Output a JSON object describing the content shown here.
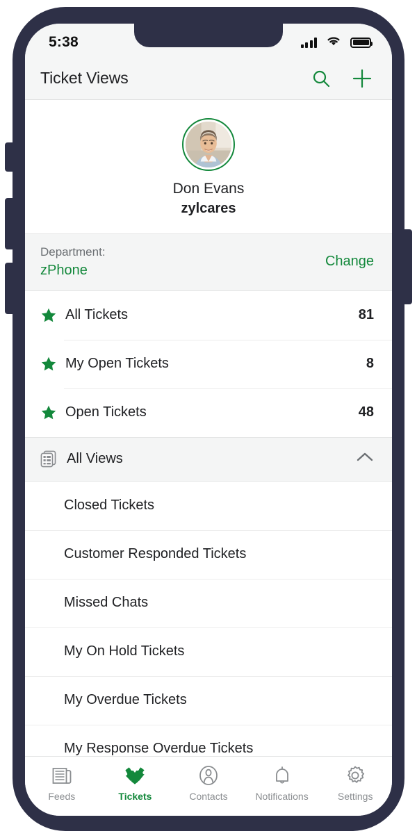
{
  "device": {
    "frame_color": "#2E3047",
    "accent_color": "#13883B"
  },
  "status_bar": {
    "time": "5:38",
    "signal_icon": "cellular-signal-icon",
    "wifi_icon": "wifi-icon",
    "battery_icon": "battery-full-icon"
  },
  "header": {
    "title": "Ticket Views",
    "search_icon": "search-icon",
    "add_icon": "plus-icon"
  },
  "profile": {
    "avatar": "user-avatar",
    "name": "Don Evans",
    "handle": "zylcares"
  },
  "department": {
    "label": "Department:",
    "value": "zPhone",
    "change_label": "Change"
  },
  "favorites": [
    {
      "icon": "star-icon",
      "label": "All Tickets",
      "count": "81"
    },
    {
      "icon": "star-icon",
      "label": "My Open Tickets",
      "count": "8"
    },
    {
      "icon": "star-icon",
      "label": "Open Tickets",
      "count": "48"
    }
  ],
  "all_views_section": {
    "icon": "list-documents-icon",
    "title": "All Views",
    "collapse_icon": "chevron-up-icon",
    "expanded": true
  },
  "views": [
    {
      "label": "Closed Tickets"
    },
    {
      "label": "Customer Responded Tickets"
    },
    {
      "label": "Missed Chats"
    },
    {
      "label": "My On Hold Tickets"
    },
    {
      "label": "My Overdue Tickets"
    },
    {
      "label": "My Response Overdue Tickets"
    }
  ],
  "tab_bar": {
    "tabs": [
      {
        "icon": "newspaper-icon",
        "label": "Feeds",
        "active": false
      },
      {
        "icon": "tickets-icon",
        "label": "Tickets",
        "active": true
      },
      {
        "icon": "contact-person-icon",
        "label": "Contacts",
        "active": false
      },
      {
        "icon": "bell-icon",
        "label": "Notifications",
        "active": false
      },
      {
        "icon": "gear-icon",
        "label": "Settings",
        "active": false
      }
    ]
  }
}
